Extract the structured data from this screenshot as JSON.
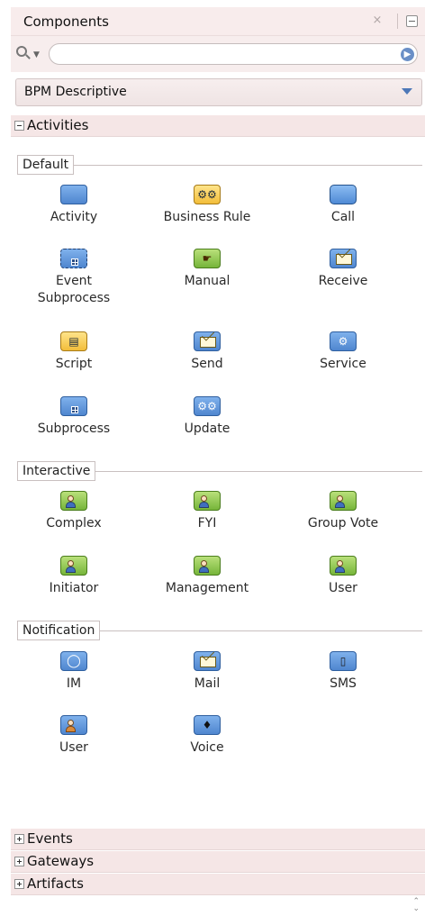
{
  "panel": {
    "title": "Components",
    "close_glyph": "×",
    "search_placeholder": "",
    "search_value": "",
    "dropdown_selected": "BPM Descriptive"
  },
  "sections": {
    "activities": "Activities",
    "events": "Events",
    "gateways": "Gateways",
    "artifacts": "Artifacts"
  },
  "groups": {
    "default": {
      "label": "Default",
      "items": [
        "Activity",
        "Business Rule",
        "Call",
        "Event\nSubprocess",
        "Manual",
        "Receive",
        "Script",
        "Send",
        "Service",
        "Subprocess",
        "Update"
      ]
    },
    "interactive": {
      "label": "Interactive",
      "items": [
        "Complex",
        "FYI",
        "Group Vote",
        "Initiator",
        "Management",
        "User"
      ]
    },
    "notification": {
      "label": "Notification",
      "items": [
        "IM",
        "Mail",
        "SMS",
        "User",
        "Voice"
      ]
    }
  },
  "colors": {
    "header_bg": "#f8ecec",
    "accent_blue": "#4d78b8"
  }
}
